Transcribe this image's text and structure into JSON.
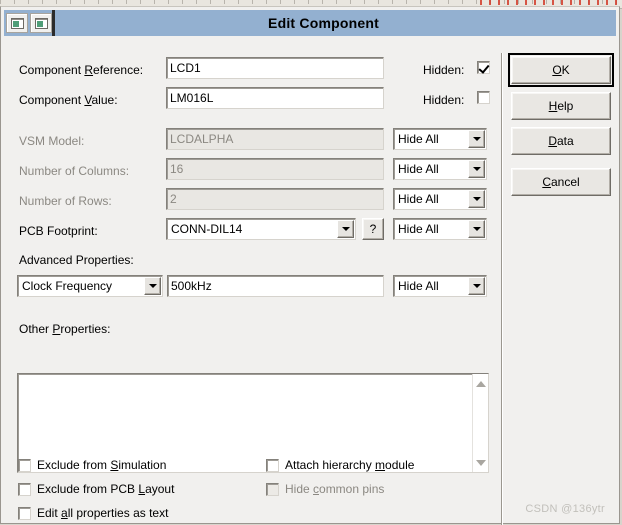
{
  "window": {
    "title": "Edit Component",
    "system_icons": [
      "window-restore-icon",
      "window-minimize-icon"
    ]
  },
  "fields": {
    "component_reference": {
      "label_prefix": "Component ",
      "label_accel": "R",
      "label_suffix": "eference:",
      "value": "LCD1",
      "hidden_label": "Hidden:",
      "hidden_checked": true
    },
    "component_value": {
      "label_prefix": "Component ",
      "label_accel": "V",
      "label_suffix": "alue:",
      "value": "LM016L",
      "hidden_label": "Hidden:",
      "hidden_checked": false
    },
    "vsm_model": {
      "label": "VSM Model:",
      "value": "LCDALPHA",
      "disabled": true,
      "visibility": "Hide All"
    },
    "number_of_columns": {
      "label": "Number of Columns:",
      "value": "16",
      "disabled": true,
      "visibility": "Hide All"
    },
    "number_of_rows": {
      "label": "Number of Rows:",
      "value": "2",
      "disabled": true,
      "visibility": "Hide All"
    },
    "pcb_footprint": {
      "label": "PCB Footprint:",
      "value": "CONN-DIL14",
      "help_button": "?",
      "visibility": "Hide All"
    },
    "advanced_properties": {
      "label": "Advanced Properties:",
      "property_name": "Clock Frequency",
      "property_value": "500kHz",
      "visibility": "Hide All"
    },
    "other_properties": {
      "label_prefix": "Other ",
      "label_accel": "P",
      "label_suffix": "roperties:",
      "value": ""
    }
  },
  "checkboxes": {
    "left": [
      {
        "name": "exclude-from-simulation",
        "prefix": "Exclude from ",
        "accel": "S",
        "suffix": "imulation",
        "checked": false,
        "disabled": false
      },
      {
        "name": "exclude-from-pcb-layout",
        "prefix": "Exclude from PCB ",
        "accel": "L",
        "suffix": "ayout",
        "checked": false,
        "disabled": false
      },
      {
        "name": "edit-all-properties-as-text",
        "prefix": "Edit ",
        "accel": "a",
        "suffix": "ll properties as text",
        "checked": false,
        "disabled": false
      }
    ],
    "right": [
      {
        "name": "attach-hierarchy-module",
        "prefix": "Attach hierarchy ",
        "accel": "m",
        "suffix": "odule",
        "checked": false,
        "disabled": false
      },
      {
        "name": "hide-common-pins",
        "prefix": "Hide ",
        "accel": "c",
        "suffix": "ommon pins",
        "checked": false,
        "disabled": true
      }
    ]
  },
  "buttons": [
    {
      "name": "ok-button",
      "prefix": "",
      "accel": "O",
      "suffix": "K",
      "default": true
    },
    {
      "name": "help-button",
      "prefix": "",
      "accel": "H",
      "suffix": "elp",
      "default": false
    },
    {
      "name": "data-button",
      "prefix": "",
      "accel": "D",
      "suffix": "ata",
      "default": false
    },
    {
      "name": "cancel-button",
      "prefix": "",
      "accel": "C",
      "suffix": "ancel",
      "default": false
    }
  ],
  "watermark": "CSDN @136ytr",
  "colors": {
    "titlebar": "#93b0d0",
    "dialog_bg": "#f1f0ee",
    "field_bg": "#ffffff",
    "field_disabled_bg": "#e9e7e3",
    "disabled_text": "#8b8882",
    "watermark": "#c2c0bb"
  }
}
